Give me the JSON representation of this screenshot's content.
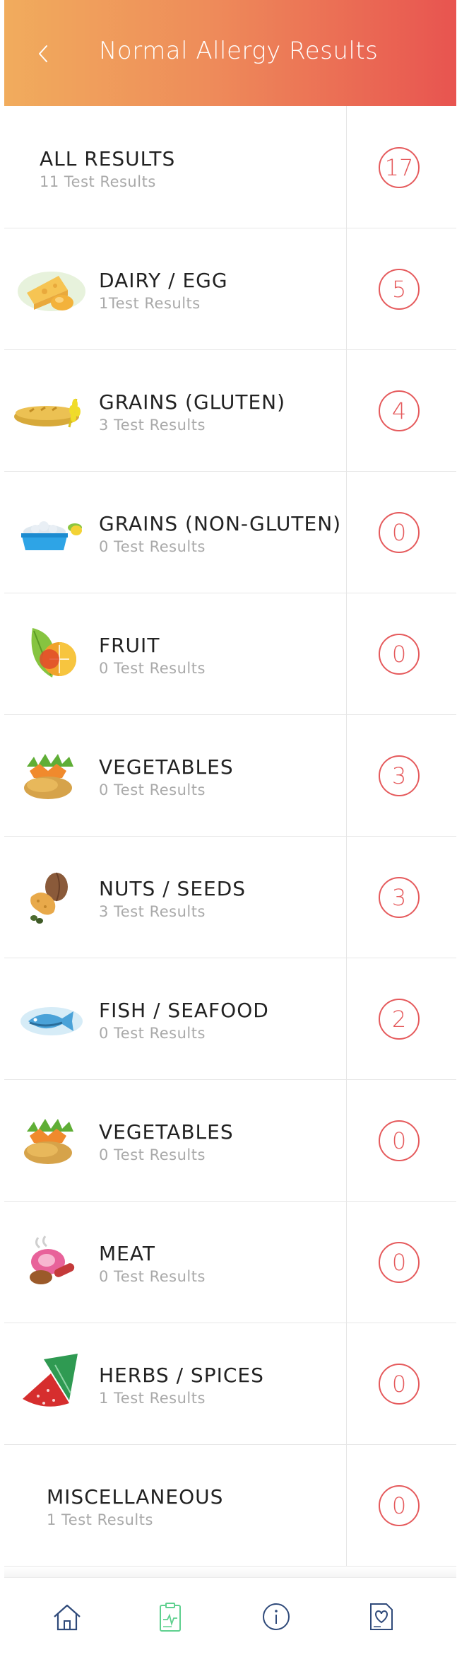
{
  "header": {
    "title": "Normal Allergy Results"
  },
  "results": [
    {
      "label": "ALL RESULTS",
      "sub": "11 Test Results",
      "count": "17",
      "icon": "none-icon"
    },
    {
      "label": "DAIRY / EGG",
      "sub": "1Test Results",
      "count": "5",
      "icon": "cheese-egg-icon"
    },
    {
      "label": "GRAINS (GLUTEN)",
      "sub": "3 Test Results",
      "count": "4",
      "icon": "bread-wheat-icon"
    },
    {
      "label": "GRAINS (NON-GLUTEN)",
      "sub": "0 Test Results",
      "count": "0",
      "icon": "rice-bowl-icon"
    },
    {
      "label": "FRUIT",
      "sub": "0 Test Results",
      "count": "0",
      "icon": "fruit-icon"
    },
    {
      "label": "VEGETABLES",
      "sub": "0 Test Results",
      "count": "3",
      "icon": "vegetables-icon"
    },
    {
      "label": "NUTS / SEEDS",
      "sub": "3 Test Results",
      "count": "3",
      "icon": "nuts-icon"
    },
    {
      "label": "FISH / SEAFOOD",
      "sub": "0 Test Results",
      "count": "2",
      "icon": "fish-icon"
    },
    {
      "label": "VEGETABLES",
      "sub": "0 Test Results",
      "count": "0",
      "icon": "vegetables-icon"
    },
    {
      "label": "MEAT",
      "sub": "0 Test Results",
      "count": "0",
      "icon": "meat-icon"
    },
    {
      "label": "HERBS / SPICES",
      "sub": "1 Test Results",
      "count": "0",
      "icon": "herbs-spices-icon"
    },
    {
      "label": "MISCELLANEOUS",
      "sub": "1 Test Results",
      "count": "0",
      "icon": "none-icon"
    }
  ],
  "tabs": [
    {
      "name": "home-icon",
      "active": false
    },
    {
      "name": "clipboard-icon",
      "active": true
    },
    {
      "name": "info-icon",
      "active": false
    },
    {
      "name": "health-document-icon",
      "active": false
    }
  ],
  "colors": {
    "header_start": "#f1ac5d",
    "header_end": "#e85450",
    "badge": "#e55a5c",
    "active_tab": "#5fd08f",
    "inactive_tab": "#2f4a7a"
  }
}
